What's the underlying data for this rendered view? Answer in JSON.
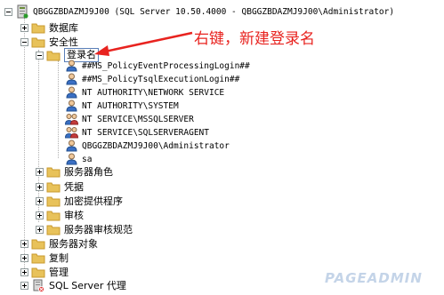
{
  "tree": {
    "server": {
      "label": "QBGGZBDAZMJ9J00 (SQL Server 10.50.4000 - QBGGZBDAZMJ9J00\\Administrator)"
    },
    "databases": {
      "label": "数据库"
    },
    "security": {
      "label": "安全性"
    },
    "logins": {
      "label": "登录名",
      "items": [
        {
          "label": "##MS_PolicyEventProcessingLogin##",
          "icon": "login-user-icon"
        },
        {
          "label": "##MS_PolicyTsqlExecutionLogin##",
          "icon": "login-user-icon"
        },
        {
          "label": "NT AUTHORITY\\NETWORK SERVICE",
          "icon": "login-user-icon"
        },
        {
          "label": "NT AUTHORITY\\SYSTEM",
          "icon": "login-user-icon"
        },
        {
          "label": "NT SERVICE\\MSSQLSERVER",
          "icon": "login-group-icon"
        },
        {
          "label": "NT SERVICE\\SQLSERVERAGENT",
          "icon": "login-group-icon"
        },
        {
          "label": "QBGGZBDAZMJ9J00\\Administrator",
          "icon": "login-user-icon"
        },
        {
          "label": "sa",
          "icon": "login-user-icon"
        }
      ]
    },
    "security_children": [
      {
        "label": "服务器角色"
      },
      {
        "label": "凭据"
      },
      {
        "label": "加密提供程序"
      },
      {
        "label": "审核"
      },
      {
        "label": "服务器审核规范"
      }
    ],
    "root_children": [
      {
        "label": "服务器对象"
      },
      {
        "label": "复制"
      },
      {
        "label": "管理"
      }
    ],
    "agent": {
      "label": "SQL Server 代理"
    }
  },
  "annotation": {
    "text": "右键，新建登录名",
    "color": "#e8231f"
  },
  "watermark": {
    "text": "PAGEADMIN"
  },
  "colors": {
    "folder": "#e8c25a",
    "folder_dark": "#c99a2e",
    "arrow": "#e8231f"
  }
}
